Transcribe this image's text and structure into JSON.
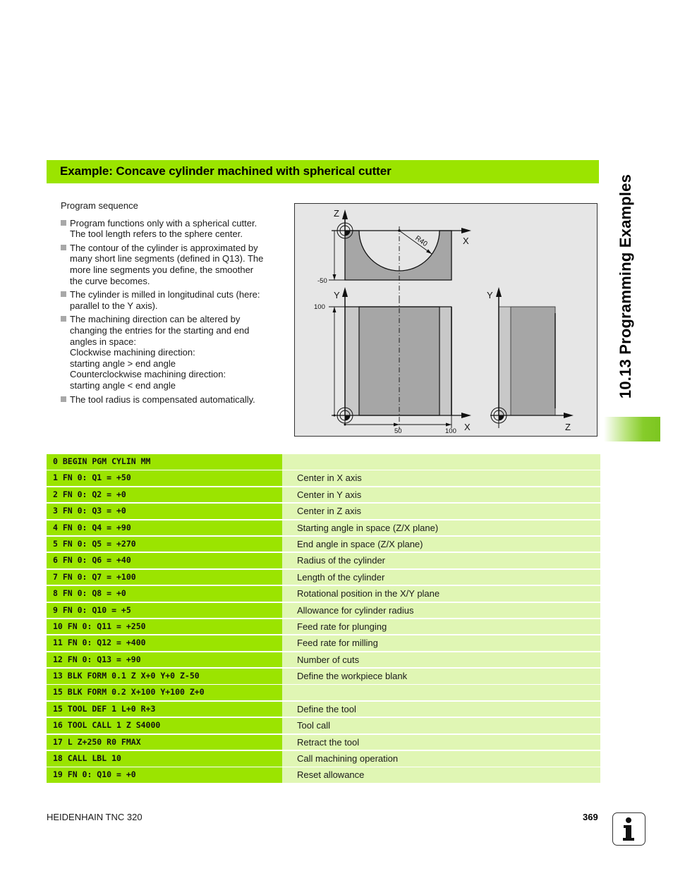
{
  "header": {
    "title": "Example: Concave cylinder machined with spherical cutter"
  },
  "side_tab": {
    "title": "10.13 Programming Examples"
  },
  "intro": {
    "sequence_label": "Program sequence",
    "bullets": [
      {
        "lines": [
          "Program functions only with a spherical cutter.",
          "The tool length refers to the sphere center."
        ]
      },
      {
        "lines": [
          "The contour of the cylinder is approximated by",
          "many short line segments (defined in Q13). The",
          "more line segments you define, the smoother",
          "the curve becomes."
        ]
      },
      {
        "lines": [
          "The cylinder is milled in longitudinal cuts (here:",
          "parallel to the Y axis)."
        ]
      },
      {
        "lines": [
          "The machining direction can be altered by",
          "changing the entries for the starting and end",
          "angles in space:",
          "Clockwise machining direction:",
          "starting angle > end angle",
          "Counterclockwise machining direction:",
          "starting angle < end angle"
        ]
      },
      {
        "lines": [
          "The tool radius is compensated automatically."
        ]
      }
    ]
  },
  "diagram": {
    "top_view": {
      "axis_vertical": "Z",
      "axis_horizontal": "X",
      "dim_depth": "-50",
      "radius_label": "R40"
    },
    "front_view": {
      "axis_vertical": "Y",
      "axis_horizontal": "X",
      "dim_height": "100",
      "dim_center": "50",
      "dim_width": "100"
    },
    "side_view": {
      "axis_vertical": "Y",
      "axis_horizontal": "Z"
    },
    "colors": {
      "background": "#e6e6e6",
      "workpiece_dark": "#a6a6a6",
      "workpiece_light": "#c8c8c8"
    }
  },
  "program": {
    "rows": [
      {
        "code": "0 BEGIN PGM CYLIN MM",
        "comment": ""
      },
      {
        "code": "1 FN 0: Q1 = +50",
        "comment": "Center in X axis"
      },
      {
        "code": "2 FN 0: Q2 = +0",
        "comment": "Center in Y axis"
      },
      {
        "code": "3 FN 0: Q3 = +0",
        "comment": "Center in Z axis"
      },
      {
        "code": "4 FN 0: Q4 = +90",
        "comment": "Starting angle in space (Z/X plane)"
      },
      {
        "code": "5 FN 0: Q5 = +270",
        "comment": "End angle in space (Z/X plane)"
      },
      {
        "code": "6 FN 0: Q6 = +40",
        "comment": "Radius of the cylinder"
      },
      {
        "code": "7 FN 0: Q7 = +100",
        "comment": "Length of the cylinder"
      },
      {
        "code": "8 FN 0: Q8 = +0",
        "comment": "Rotational position in the X/Y plane"
      },
      {
        "code": "9 FN 0: Q10 = +5",
        "comment": "Allowance for cylinder radius"
      },
      {
        "code": "10 FN 0: Q11 = +250",
        "comment": "Feed rate for plunging"
      },
      {
        "code": "11 FN 0: Q12 = +400",
        "comment": "Feed rate for milling"
      },
      {
        "code": "12 FN 0: Q13 = +90",
        "comment": "Number of cuts"
      },
      {
        "code": "13 BLK FORM 0.1 Z X+0 Y+0 Z-50",
        "comment": "Define the workpiece blank"
      },
      {
        "code": "15 BLK FORM 0.2 X+100 Y+100 Z+0",
        "comment": ""
      },
      {
        "code": "15 TOOL DEF 1 L+0 R+3",
        "comment": "Define the tool"
      },
      {
        "code": "16 TOOL CALL 1 Z S4000",
        "comment": "Tool call"
      },
      {
        "code": "17 L Z+250 R0 FMAX",
        "comment": "Retract the tool"
      },
      {
        "code": "18 CALL LBL 10",
        "comment": "Call machining operation"
      },
      {
        "code": "19 FN 0: Q10 = +0",
        "comment": "Reset allowance"
      }
    ],
    "colors": {
      "code_bg": "#9be400",
      "comment_bg": "#e0f6b4"
    }
  },
  "footer": {
    "product": "HEIDENHAIN TNC 320",
    "page_number": "369",
    "icon": "info-icon"
  }
}
